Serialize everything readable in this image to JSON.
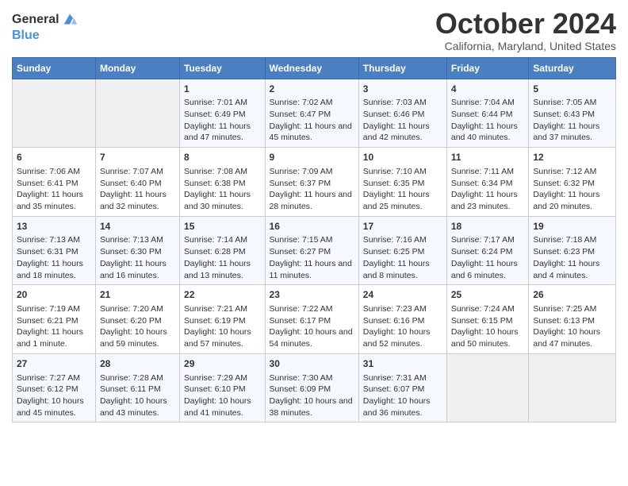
{
  "logo": {
    "general": "General",
    "blue": "Blue"
  },
  "title": "October 2024",
  "subtitle": "California, Maryland, United States",
  "days_of_week": [
    "Sunday",
    "Monday",
    "Tuesday",
    "Wednesday",
    "Thursday",
    "Friday",
    "Saturday"
  ],
  "weeks": [
    [
      {
        "day": "",
        "info": ""
      },
      {
        "day": "",
        "info": ""
      },
      {
        "day": "1",
        "info": "Sunrise: 7:01 AM\nSunset: 6:49 PM\nDaylight: 11 hours and 47 minutes."
      },
      {
        "day": "2",
        "info": "Sunrise: 7:02 AM\nSunset: 6:47 PM\nDaylight: 11 hours and 45 minutes."
      },
      {
        "day": "3",
        "info": "Sunrise: 7:03 AM\nSunset: 6:46 PM\nDaylight: 11 hours and 42 minutes."
      },
      {
        "day": "4",
        "info": "Sunrise: 7:04 AM\nSunset: 6:44 PM\nDaylight: 11 hours and 40 minutes."
      },
      {
        "day": "5",
        "info": "Sunrise: 7:05 AM\nSunset: 6:43 PM\nDaylight: 11 hours and 37 minutes."
      }
    ],
    [
      {
        "day": "6",
        "info": "Sunrise: 7:06 AM\nSunset: 6:41 PM\nDaylight: 11 hours and 35 minutes."
      },
      {
        "day": "7",
        "info": "Sunrise: 7:07 AM\nSunset: 6:40 PM\nDaylight: 11 hours and 32 minutes."
      },
      {
        "day": "8",
        "info": "Sunrise: 7:08 AM\nSunset: 6:38 PM\nDaylight: 11 hours and 30 minutes."
      },
      {
        "day": "9",
        "info": "Sunrise: 7:09 AM\nSunset: 6:37 PM\nDaylight: 11 hours and 28 minutes."
      },
      {
        "day": "10",
        "info": "Sunrise: 7:10 AM\nSunset: 6:35 PM\nDaylight: 11 hours and 25 minutes."
      },
      {
        "day": "11",
        "info": "Sunrise: 7:11 AM\nSunset: 6:34 PM\nDaylight: 11 hours and 23 minutes."
      },
      {
        "day": "12",
        "info": "Sunrise: 7:12 AM\nSunset: 6:32 PM\nDaylight: 11 hours and 20 minutes."
      }
    ],
    [
      {
        "day": "13",
        "info": "Sunrise: 7:13 AM\nSunset: 6:31 PM\nDaylight: 11 hours and 18 minutes."
      },
      {
        "day": "14",
        "info": "Sunrise: 7:13 AM\nSunset: 6:30 PM\nDaylight: 11 hours and 16 minutes."
      },
      {
        "day": "15",
        "info": "Sunrise: 7:14 AM\nSunset: 6:28 PM\nDaylight: 11 hours and 13 minutes."
      },
      {
        "day": "16",
        "info": "Sunrise: 7:15 AM\nSunset: 6:27 PM\nDaylight: 11 hours and 11 minutes."
      },
      {
        "day": "17",
        "info": "Sunrise: 7:16 AM\nSunset: 6:25 PM\nDaylight: 11 hours and 8 minutes."
      },
      {
        "day": "18",
        "info": "Sunrise: 7:17 AM\nSunset: 6:24 PM\nDaylight: 11 hours and 6 minutes."
      },
      {
        "day": "19",
        "info": "Sunrise: 7:18 AM\nSunset: 6:23 PM\nDaylight: 11 hours and 4 minutes."
      }
    ],
    [
      {
        "day": "20",
        "info": "Sunrise: 7:19 AM\nSunset: 6:21 PM\nDaylight: 11 hours and 1 minute."
      },
      {
        "day": "21",
        "info": "Sunrise: 7:20 AM\nSunset: 6:20 PM\nDaylight: 10 hours and 59 minutes."
      },
      {
        "day": "22",
        "info": "Sunrise: 7:21 AM\nSunset: 6:19 PM\nDaylight: 10 hours and 57 minutes."
      },
      {
        "day": "23",
        "info": "Sunrise: 7:22 AM\nSunset: 6:17 PM\nDaylight: 10 hours and 54 minutes."
      },
      {
        "day": "24",
        "info": "Sunrise: 7:23 AM\nSunset: 6:16 PM\nDaylight: 10 hours and 52 minutes."
      },
      {
        "day": "25",
        "info": "Sunrise: 7:24 AM\nSunset: 6:15 PM\nDaylight: 10 hours and 50 minutes."
      },
      {
        "day": "26",
        "info": "Sunrise: 7:25 AM\nSunset: 6:13 PM\nDaylight: 10 hours and 47 minutes."
      }
    ],
    [
      {
        "day": "27",
        "info": "Sunrise: 7:27 AM\nSunset: 6:12 PM\nDaylight: 10 hours and 45 minutes."
      },
      {
        "day": "28",
        "info": "Sunrise: 7:28 AM\nSunset: 6:11 PM\nDaylight: 10 hours and 43 minutes."
      },
      {
        "day": "29",
        "info": "Sunrise: 7:29 AM\nSunset: 6:10 PM\nDaylight: 10 hours and 41 minutes."
      },
      {
        "day": "30",
        "info": "Sunrise: 7:30 AM\nSunset: 6:09 PM\nDaylight: 10 hours and 38 minutes."
      },
      {
        "day": "31",
        "info": "Sunrise: 7:31 AM\nSunset: 6:07 PM\nDaylight: 10 hours and 36 minutes."
      },
      {
        "day": "",
        "info": ""
      },
      {
        "day": "",
        "info": ""
      }
    ]
  ]
}
